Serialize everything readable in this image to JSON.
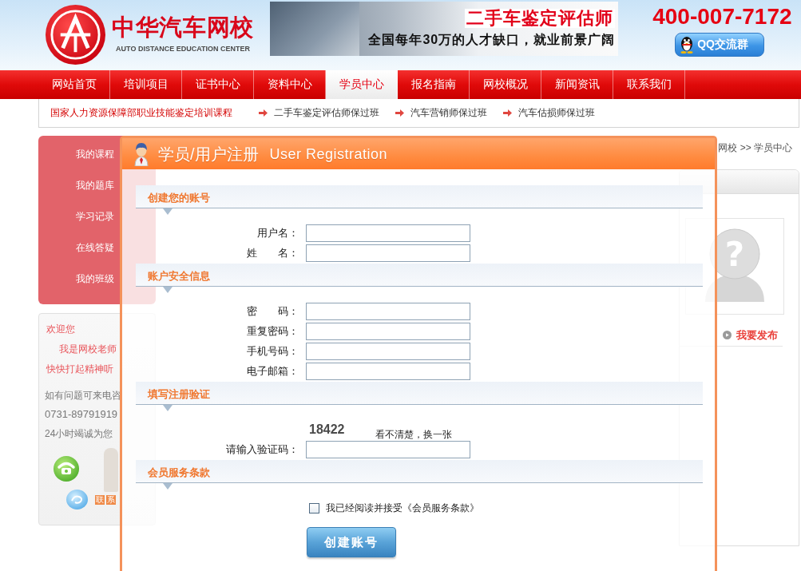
{
  "header": {
    "logo_title": "中华汽车网校",
    "logo_subtitle": "AUTO DISTANCE EDUCATION CENTER",
    "banner_title": "二手车鉴定评估师",
    "banner_slogan": "全国每年30万的人才缺口，就业前景广阔",
    "hotline": "400-007-7172",
    "qq_button": "QQ交流群"
  },
  "nav": [
    {
      "label": "网站首页",
      "selected": false
    },
    {
      "label": "培训项目",
      "selected": false
    },
    {
      "label": "证书中心",
      "selected": false
    },
    {
      "label": "资料中心",
      "selected": false
    },
    {
      "label": "学员中心",
      "selected": true
    },
    {
      "label": "报名指南",
      "selected": false
    },
    {
      "label": "网校概况",
      "selected": false
    },
    {
      "label": "新闻资讯",
      "selected": false
    },
    {
      "label": "联系我们",
      "selected": false
    }
  ],
  "subnav": {
    "title": "国家人力资源保障部职业技能鉴定培训课程",
    "links": [
      "二手车鉴定评估师保过班",
      "汽车营销师保过班",
      "汽车估损师保过班"
    ]
  },
  "sidebar": {
    "menu": [
      "我的课程",
      "我的题库",
      "学习记录",
      "在线答疑",
      "我的班级"
    ],
    "contact_panel": {
      "welcome": "欢迎您",
      "teacher": "我是网校老师",
      "motto": "快快打起精神听",
      "note": "如有问题可来电咨",
      "phone": "0731-89791919",
      "service": "24小时竭诚为您",
      "tiles": [
        "联",
        "系"
      ]
    }
  },
  "breadcrumb": "网校 >> 学员中心",
  "side_panel": {
    "avatar_mark": "?",
    "publish_link": "我要发布"
  },
  "dialog": {
    "title": "学员/用户注册",
    "subtitle": "User Registration",
    "sections": [
      {
        "title": "创建您的账号",
        "rows": [
          {
            "kind": "field",
            "label": "用户名："
          },
          {
            "kind": "field",
            "label": "姓　　名："
          }
        ]
      },
      {
        "title": "账户安全信息",
        "rows": [
          {
            "kind": "field",
            "label": "密　　码："
          },
          {
            "kind": "field",
            "label": "重复密码："
          },
          {
            "kind": "field",
            "label": "手机号码："
          },
          {
            "kind": "field",
            "label": "电子邮箱："
          }
        ]
      },
      {
        "title": "填写注册验证",
        "rows": [
          {
            "kind": "captcha",
            "code": "18422",
            "link": "看不清楚，换一张"
          },
          {
            "kind": "field",
            "label": "请输入验证码："
          }
        ]
      },
      {
        "title": "会员服务条款",
        "rows": [
          {
            "kind": "checkbox",
            "label": "我已经阅读并接受《会员服务条款》",
            "checked": false
          }
        ]
      }
    ],
    "submit": "创建账号"
  }
}
